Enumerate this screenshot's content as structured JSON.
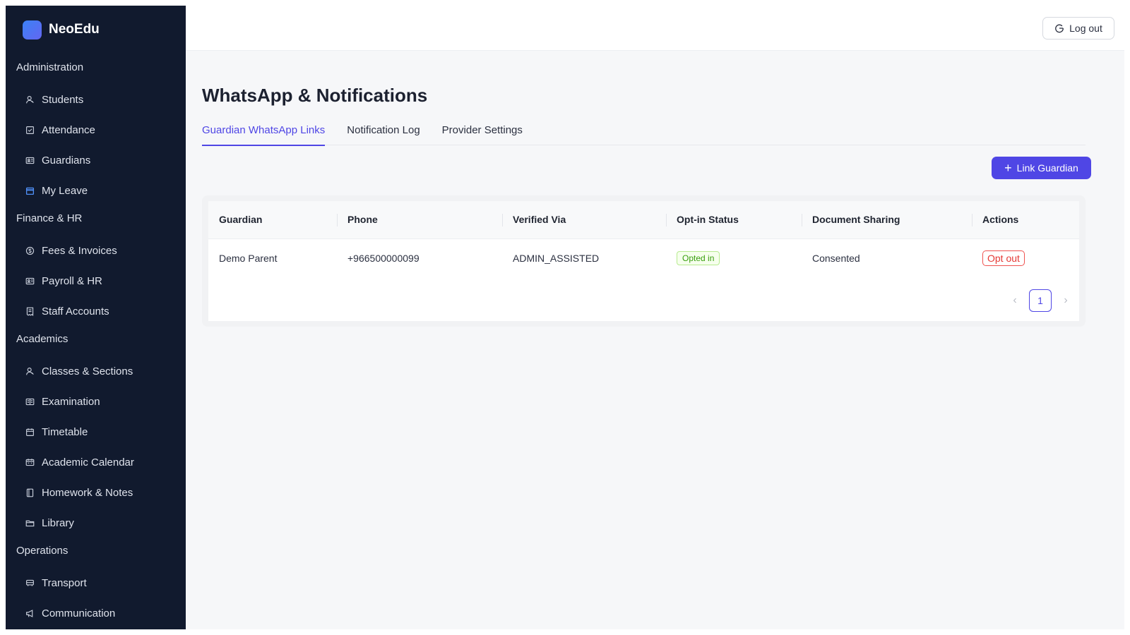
{
  "brand": {
    "name": "NeoEdu"
  },
  "sidebar": {
    "groups": [
      {
        "label": "Administration",
        "items": [
          {
            "label": "Students",
            "icon": "user-icon"
          },
          {
            "label": "Attendance",
            "icon": "checkbox-icon"
          },
          {
            "label": "Guardians",
            "icon": "id-card-icon"
          },
          {
            "label": "My Leave",
            "icon": "calendar-icon"
          }
        ]
      },
      {
        "label": "Finance & HR",
        "items": [
          {
            "label": "Fees & Invoices",
            "icon": "dollar-icon"
          },
          {
            "label": "Payroll & HR",
            "icon": "id-card-icon"
          },
          {
            "label": "Staff Accounts",
            "icon": "receipt-icon"
          }
        ]
      },
      {
        "label": "Academics",
        "items": [
          {
            "label": "Classes & Sections",
            "icon": "user-icon"
          },
          {
            "label": "Examination",
            "icon": "book-icon"
          },
          {
            "label": "Timetable",
            "icon": "calendar-icon"
          },
          {
            "label": "Academic Calendar",
            "icon": "calendar-icon"
          },
          {
            "label": "Homework & Notes",
            "icon": "notebook-icon"
          },
          {
            "label": "Library",
            "icon": "folder-icon"
          }
        ]
      },
      {
        "label": "Operations",
        "items": [
          {
            "label": "Transport",
            "icon": "bus-icon"
          },
          {
            "label": "Communication",
            "icon": "megaphone-icon"
          }
        ]
      }
    ]
  },
  "header": {
    "logout_label": "Log out"
  },
  "main": {
    "title": "WhatsApp & Notifications",
    "tabs": [
      {
        "label": "Guardian WhatsApp Links"
      },
      {
        "label": "Notification Log"
      },
      {
        "label": "Provider Settings"
      }
    ],
    "link_button_label": "Link Guardian",
    "table": {
      "columns": [
        "Guardian",
        "Phone",
        "Verified Via",
        "Opt-in Status",
        "Document Sharing",
        "Actions"
      ],
      "rows": [
        {
          "guardian": "Demo Parent",
          "phone": "+966500000099",
          "verified_via": "ADMIN_ASSISTED",
          "opt_in_status": "Opted in",
          "document_sharing": "Consented",
          "action": "Opt out"
        }
      ]
    },
    "pagination": {
      "current_page": "1",
      "prev": "‹",
      "next": "›"
    }
  },
  "colors": {
    "sidebar_bg": "#111a2e",
    "accent": "#4f46e5",
    "success": "#389e0d",
    "danger": "#e53935"
  }
}
